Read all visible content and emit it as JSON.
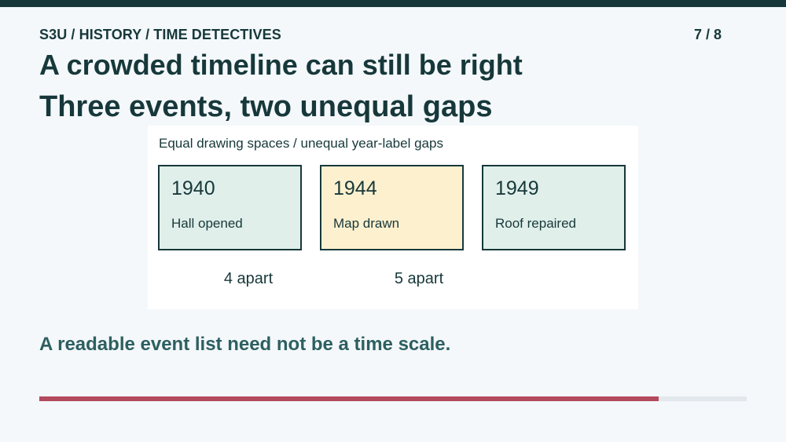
{
  "header": {
    "breadcrumb": "S3U / HISTORY / TIME DETECTIVES",
    "page_counter": "7 / 8"
  },
  "slide": {
    "title": "A crowded timeline can still be right",
    "subtitle": "Three events, two unequal gaps",
    "panel": {
      "caption": "Equal drawing spaces / unequal year-label gaps",
      "events": [
        {
          "year": "1940",
          "label": "Hall opened",
          "fill": "#e0efea"
        },
        {
          "year": "1944",
          "label": "Map drawn",
          "fill": "#fdf0cf"
        },
        {
          "year": "1949",
          "label": "Roof repaired",
          "fill": "#e0efea"
        }
      ],
      "gaps": [
        "4 apart",
        "5 apart"
      ]
    },
    "takeaway": "A readable event list need not be a time scale."
  },
  "progress": {
    "fraction": 0.875,
    "fill_color": "#b34a5e",
    "track_color": "#e2e8ec"
  },
  "colors": {
    "ink": "#17383a",
    "takeaway": "#2d5f60",
    "top_bar": "#17383a",
    "background": "#f4f8fb"
  }
}
